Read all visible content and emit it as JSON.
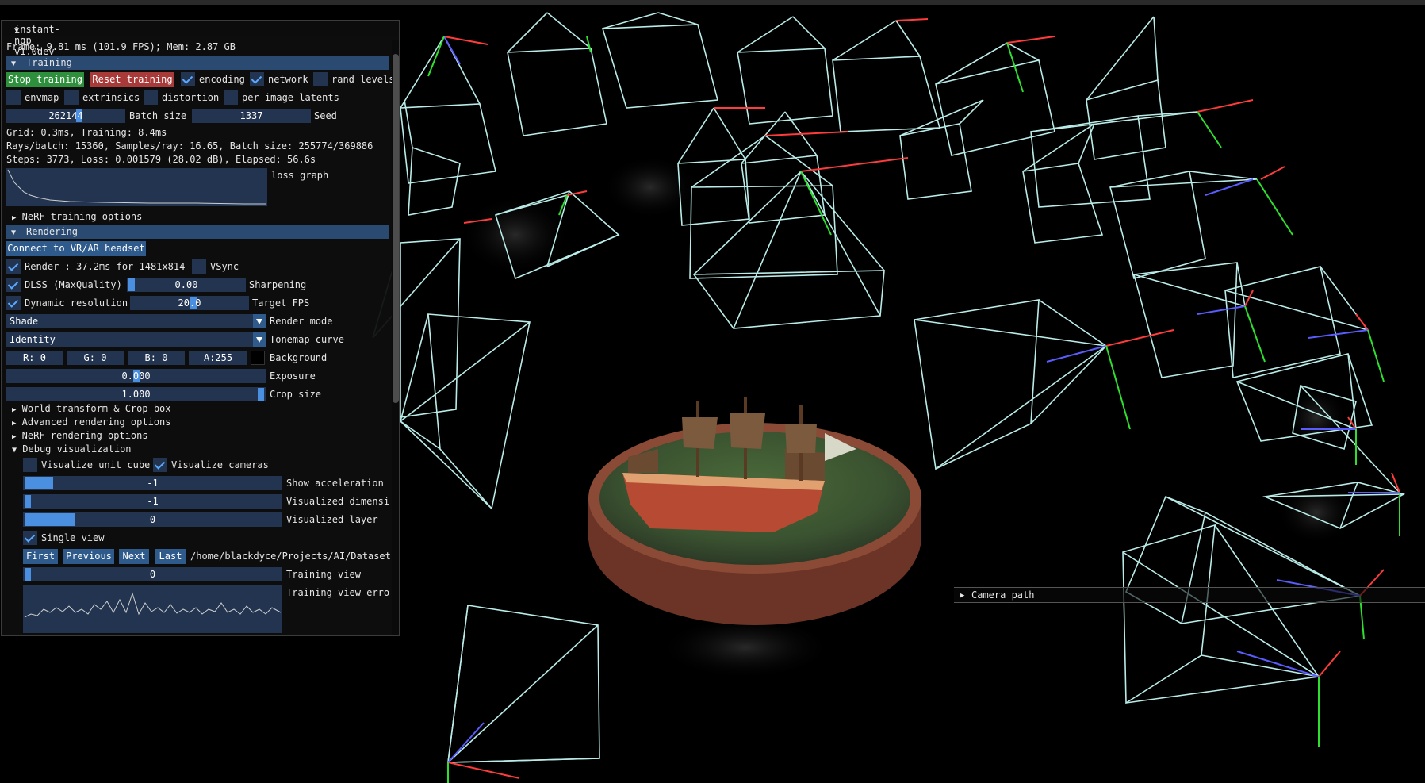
{
  "window": {
    "title": "instant-ngp v1.0dev",
    "stats_line": "Frame: 9.81 ms (101.9 FPS); Mem: 2.87 GB"
  },
  "training": {
    "header": "Training",
    "stop_button": "Stop training",
    "reset_button": "Reset training",
    "checks_row1": [
      {
        "label": "encoding",
        "checked": true
      },
      {
        "label": "network",
        "checked": true
      },
      {
        "label": "rand levels",
        "checked": false
      }
    ],
    "checks_row2": [
      {
        "label": "envmap",
        "checked": false
      },
      {
        "label": "extrinsics",
        "checked": false
      },
      {
        "label": "distortion",
        "checked": false
      },
      {
        "label": "per-image latents",
        "checked": false
      }
    ],
    "batch_size_value": "262144",
    "batch_size_label": "Batch size",
    "seed_value": "1337",
    "seed_label": "Seed",
    "timing_line": "Grid: 0.3ms, Training: 8.4ms",
    "rays_line": "Rays/batch: 15360, Samples/ray: 16.65, Batch size: 255774/369886",
    "steps_line": "Steps: 3773, Loss: 0.001579 (28.02 dB), Elapsed: 56.6s",
    "loss_graph_label": "loss graph",
    "nerf_options": "NeRF training options"
  },
  "rendering": {
    "header": "Rendering",
    "vr_button": "Connect to VR/AR headset",
    "render_check": {
      "label": "Render : 37.2ms for 1481x814",
      "checked": true
    },
    "vsync_check": {
      "label": "VSync",
      "checked": false
    },
    "dlss_check": {
      "label": "DLSS (MaxQuality)",
      "checked": true
    },
    "sharpening_value": "0.00",
    "sharpening_label": "Sharpening",
    "dynres_check": {
      "label": "Dynamic resolution",
      "checked": true
    },
    "target_fps_value": "20.0",
    "target_fps_label": "Target FPS",
    "render_mode_value": "Shade",
    "render_mode_label": "Render mode",
    "tonemap_value": "Identity",
    "tonemap_label": "Tonemap curve",
    "bg_r": "R:  0",
    "bg_g": "G:  0",
    "bg_b": "B:  0",
    "bg_a": "A:255",
    "background_label": "Background",
    "exposure_value": "0.000",
    "exposure_label": "Exposure",
    "crop_value": "1.000",
    "crop_label": "Crop size",
    "tree_items": [
      "World transform & Crop box",
      "Advanced rendering options",
      "NeRF rendering options"
    ],
    "debug_header": "Debug visualization",
    "vis_unit_cube": {
      "label": "Visualize unit cube",
      "checked": false
    },
    "vis_cameras": {
      "label": "Visualize cameras",
      "checked": true
    },
    "show_accel_value": "-1",
    "show_accel_label": "Show acceleration",
    "vis_dim_value": "-1",
    "vis_dim_label": "Visualized dimensi",
    "vis_layer_value": "0",
    "vis_layer_label": "Visualized layer",
    "single_view": {
      "label": "Single view",
      "checked": true
    },
    "nav_buttons": [
      "First",
      "Previous",
      "Next",
      "Last"
    ],
    "path_text": "/home/blackdyce/Projects/AI/Datasets",
    "training_view_value": "0",
    "training_view_label": "Training view",
    "training_view_error_label": "Training view erro"
  },
  "camera_path": {
    "label": "Camera path"
  }
}
